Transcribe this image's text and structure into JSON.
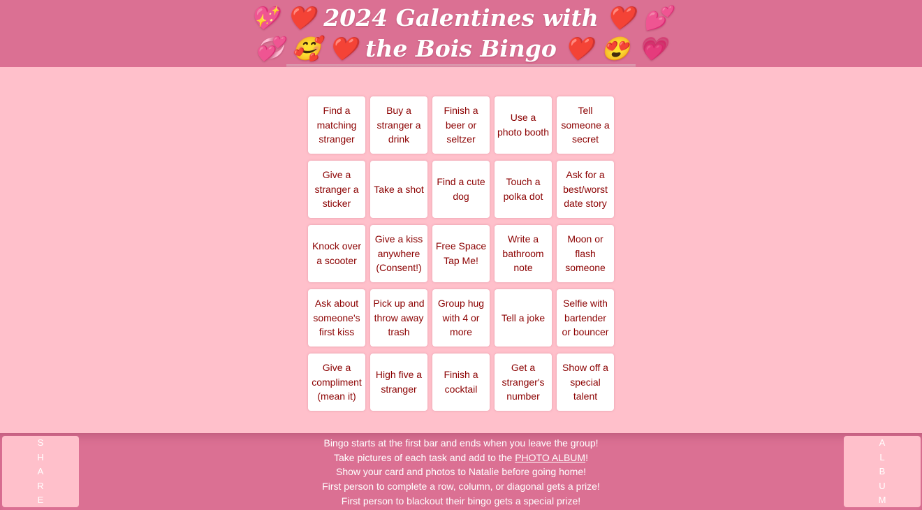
{
  "header": {
    "title_line1": "💖 ❤️ 2024 Galentines with ❤️ 💕",
    "title_line2": "💞 🥰 ❤️ the Bois Bingo ❤️ 😍 💗"
  },
  "board": {
    "cells": [
      "Find a matching stranger",
      "Buy a stranger a drink",
      "Finish a beer or seltzer",
      "Use a photo booth",
      "Tell someone a secret",
      "Give a stranger a sticker",
      "Take a shot",
      "Find a cute dog",
      "Touch a polka dot",
      "Ask for a best/worst date story",
      "Knock over a scooter",
      "Give a kiss anywhere (Consent!)",
      "Free Space Tap Me!",
      "Write a bathroom note",
      "Moon or flash someone",
      "Ask about someone's first kiss",
      "Pick up and throw away trash",
      "Group hug with 4 or more",
      "Tell a joke",
      "Selfie with bartender or bouncer",
      "Give a compliment (mean it)",
      "High five a stranger",
      "Finish a cocktail",
      "Get a stranger's number",
      "Show off a special talent"
    ]
  },
  "footer": {
    "share_letters": [
      "S",
      "H",
      "A",
      "R",
      "E"
    ],
    "album_letters": [
      "A",
      "L",
      "B",
      "U",
      "M"
    ],
    "rule1": "Bingo starts at the first bar and ends when you leave the group!",
    "rule2_pre": "Take pictures of each task and add to the ",
    "rule2_link": "PHOTO ALBUM",
    "rule2_post": "!",
    "rule3": "Show your card and photos to Natalie before going home!",
    "rule4": "First person to complete a row, column, or diagonal gets a prize!",
    "rule5": "First person to blackout their bingo gets a special prize!"
  },
  "colors": {
    "background": "#ffc0cb",
    "header": "#db7093",
    "cell_text": "#8b0000",
    "cell_bg": "#ffffff"
  }
}
